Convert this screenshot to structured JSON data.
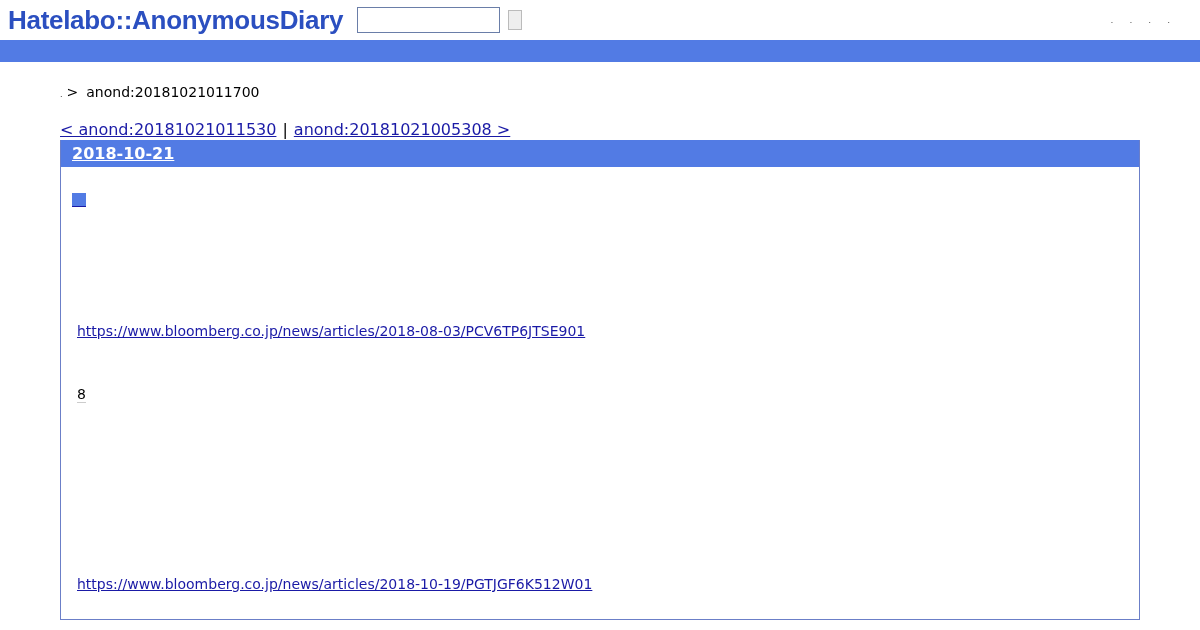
{
  "header": {
    "logo": "Hatelabo::AnonymousDiary",
    "nav_links": [
      ".",
      ".",
      ".",
      "."
    ]
  },
  "breadcrumb": {
    "home": ".",
    "separator": ">",
    "current": "anond:20181021011700"
  },
  "pager": {
    "prev": "< anond:20181021011530",
    "divider": "|",
    "next": "anond:20181021005308 >"
  },
  "entry": {
    "date": "2018-10-21",
    "body": [
      {
        "kind": "square"
      },
      {
        "kind": "link",
        "text": "https://www.bloomberg.co.jp/news/articles/2018-08-03/PCV6TP6JTSE901"
      },
      {
        "kind": "note",
        "text": "8"
      },
      {
        "kind": "link",
        "text": "https://www.bloomberg.co.jp/news/articles/2018-10-19/PGTJGF6K512W01"
      }
    ]
  }
}
